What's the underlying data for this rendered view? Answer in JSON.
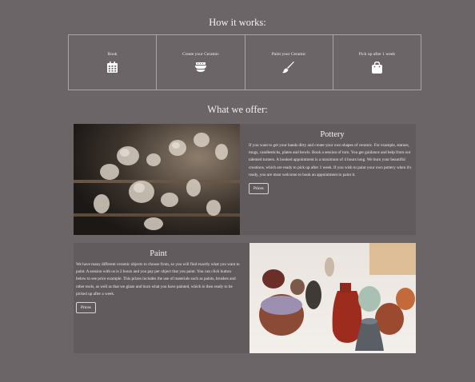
{
  "how_it_works": {
    "title": "How it works:",
    "steps": [
      {
        "label": "Book",
        "icon": "calendar-icon"
      },
      {
        "label": "Create your Ceramic",
        "icon": "bowls-icon"
      },
      {
        "label": "Paint your Ceramic",
        "icon": "paintbrush-icon"
      },
      {
        "label": "Pick up after 1 week",
        "icon": "shopping-bag-icon"
      }
    ]
  },
  "what_we_offer": {
    "title": "What we offer:",
    "pottery": {
      "title": "Pottery",
      "body": "If you want to get your hands dirty and create your own shapes of ceramic. For example, statues, mugs, candlesticks, plates and bowls. Book a session of turn. You get guidance and help from our talented turners. A booked appointment is a maximum of 4 hours long. We burn your beautiful creations, which are ready to pick up after 1 week. If you wish to paint your own pottery when it's ready, you are most welcome to book an appointment to paint it.",
      "button": "Prices",
      "image": "ceramic-pieces-on-shelves-photo"
    },
    "paint": {
      "title": "Paint",
      "body": "We have many different ceramic objects to choose from, so you will find exactly what you want to paint. A session with us is 2 hours and you pay per object that you paint. You can click button below to see price example. This prizes includes the use of materials such as paints, brushes and other tools, as well as that we glaze and burn what you have painted, which is then ready to be picked up after a week.",
      "button": "Prices",
      "image": "painted-vases-photo"
    }
  },
  "colors": {
    "background": "#6b6568",
    "card": "#615b5e",
    "border": "#a8a3a5",
    "text": "#ffffff"
  }
}
